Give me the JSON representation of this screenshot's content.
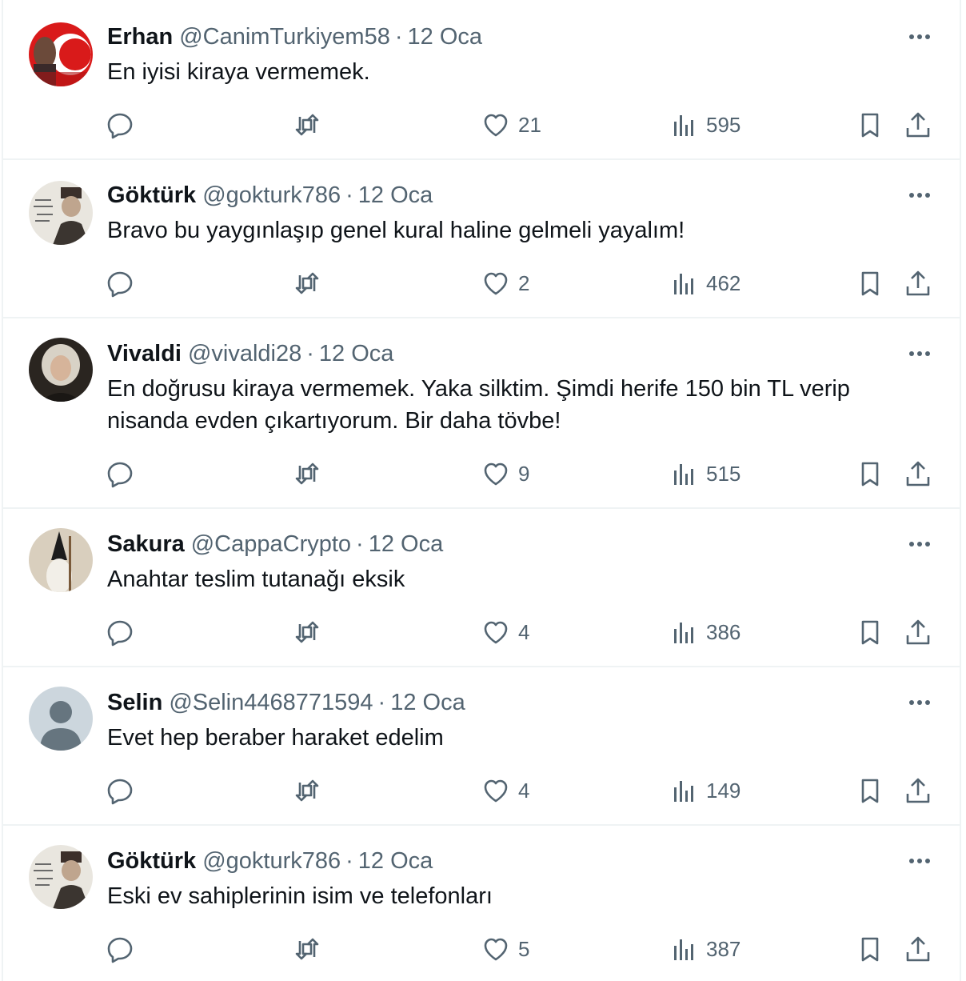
{
  "replies": [
    {
      "name": "Erhan",
      "handle": "@CanimTurkiyem58",
      "date": "12 Oca",
      "text": "En iyisi kiraya vermemek.",
      "likes": "21",
      "views": "595",
      "avatar": "flag-avatar"
    },
    {
      "name": "Göktürk",
      "handle": "@gokturk786",
      "date": "12 Oca",
      "text": "Bravo bu yaygınlaşıp genel kural haline gelmeli yayalım!",
      "likes": "2",
      "views": "462",
      "avatar": "portrait-avatar"
    },
    {
      "name": "Vivaldi",
      "handle": "@vivaldi28",
      "date": "12 Oca",
      "text": "En doğrusu kiraya vermemek. Yaka silktim. Şimdi herife 150 bin TL verip nisanda evden çıkartıyorum. Bir daha tövbe!",
      "likes": "9",
      "views": "515",
      "avatar": "painting-avatar"
    },
    {
      "name": "Sakura",
      "handle": "@CappaCrypto",
      "date": "12 Oca",
      "text": "Anahtar teslim tutanağı eksik",
      "likes": "4",
      "views": "386",
      "avatar": "hooded-figure-avatar"
    },
    {
      "name": "Selin",
      "handle": "@Selin4468771594",
      "date": "12 Oca",
      "text": "Evet hep beraber haraket edelim",
      "likes": "4",
      "views": "149",
      "avatar": "default-avatar"
    },
    {
      "name": "Göktürk",
      "handle": "@gokturk786",
      "date": "12 Oca",
      "text": "Eski ev sahiplerinin isim ve telefonları",
      "likes": "5",
      "views": "387",
      "avatar": "portrait-avatar"
    }
  ],
  "colors": {
    "text": "#0f1419",
    "secondary": "#536471",
    "border": "#eff3f4"
  }
}
